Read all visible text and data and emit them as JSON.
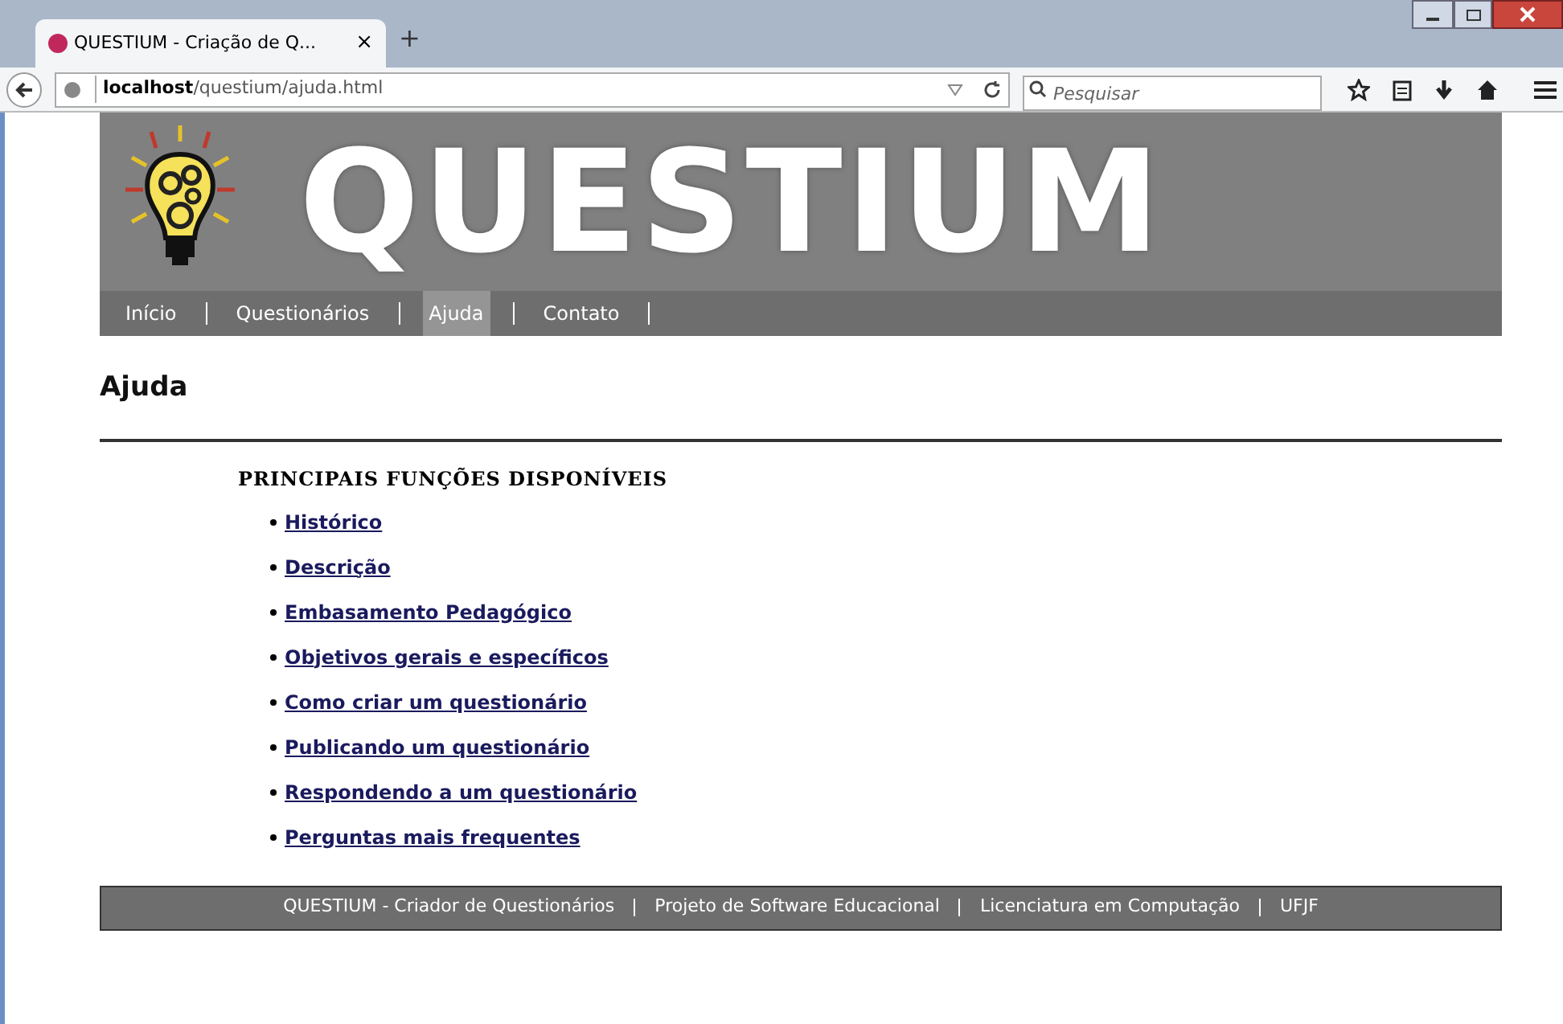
{
  "browser": {
    "tab_title": "QUESTIUM - Criação de Q...",
    "tab_close": "×",
    "new_tab": "+",
    "url_host": "localhost",
    "url_path": "/questium/ajuda.html",
    "search_placeholder": "Pesquisar"
  },
  "header": {
    "logo_text": "QUESTIUM"
  },
  "nav": [
    {
      "label": "Início",
      "selected": false
    },
    {
      "label": "Questionários",
      "selected": false
    },
    {
      "label": "Ajuda",
      "selected": true
    },
    {
      "label": "Contato",
      "selected": false
    }
  ],
  "page_title": "Ajuda",
  "section_heading": "PRINCIPAIS FUNÇÕES DISPONÍVEIS",
  "links": [
    "Histórico",
    "Descrição",
    "Embasamento Pedagógico",
    "Objetivos gerais e específicos",
    "Como criar um questionário",
    "Publicando um questionário",
    "Respondendo a um questionário",
    "Perguntas mais frequentes"
  ],
  "footer": [
    "QUESTIUM - Criador de Questionários",
    "Projeto de Software Educacional",
    "Licenciatura em Computação",
    "UFJF"
  ]
}
